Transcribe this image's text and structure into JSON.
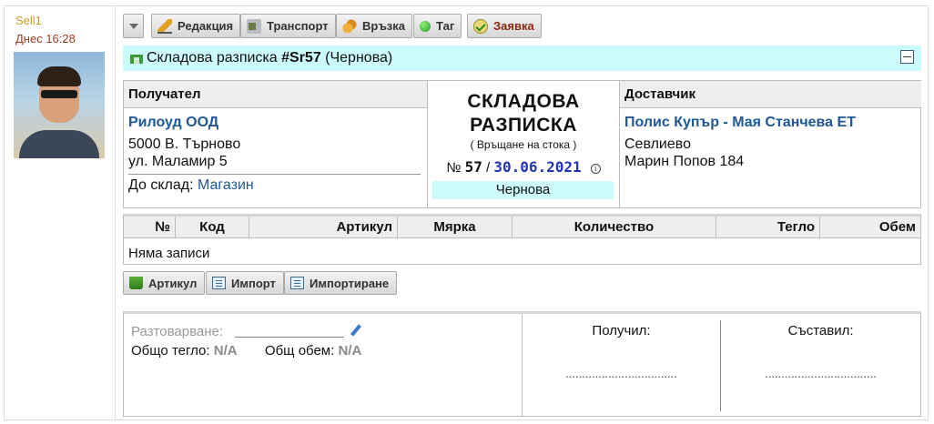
{
  "user": {
    "name": "Sell1",
    "date": "Днес 16:28"
  },
  "toolbar": {
    "edit": "Редакция",
    "transport": "Транспорт",
    "link": "Връзка",
    "tag": "Таг",
    "request": "Заявка"
  },
  "title": {
    "prefix": "Складова разписка ",
    "number": "#Sr57",
    "status": " (Чернова)"
  },
  "receiver": {
    "header": "Получател",
    "name": "Рилоуд ООД",
    "city": "5000 В. Търново",
    "street": "ул. Маламир 5",
    "store_label": "До склад: ",
    "store": "Магазин"
  },
  "document": {
    "title_line1": "СКЛАДОВА",
    "title_line2": "РАЗПИСКА",
    "subtitle": "( Връщане на стока )",
    "number_prefix": "№ ",
    "number": "57",
    "separator": " / ",
    "date": "30.06.2021",
    "status": "Чернова"
  },
  "supplier": {
    "header": "Доставчик",
    "name": "Полис Купър - Мая Станчева ЕТ",
    "city": "Севлиево",
    "street": "Марин Попов 184"
  },
  "table": {
    "columns": [
      "№",
      "Код",
      "Артикул",
      "Мярка",
      "Количество",
      "Тегло",
      "Обем"
    ],
    "empty": "Няма записи"
  },
  "actions": {
    "article": "Артикул",
    "import": "Импорт",
    "importing": "Импортиране"
  },
  "footer": {
    "unloading_label": "Разтоварване:",
    "total_weight_label": "Общо тегло: ",
    "total_weight": "N/A",
    "total_volume_label": "Общ обем: ",
    "total_volume": "N/A",
    "received_label": "Получил:",
    "received_dots": "..................................",
    "composed_label": "Съставил:",
    "composed_dots": ".................................."
  }
}
